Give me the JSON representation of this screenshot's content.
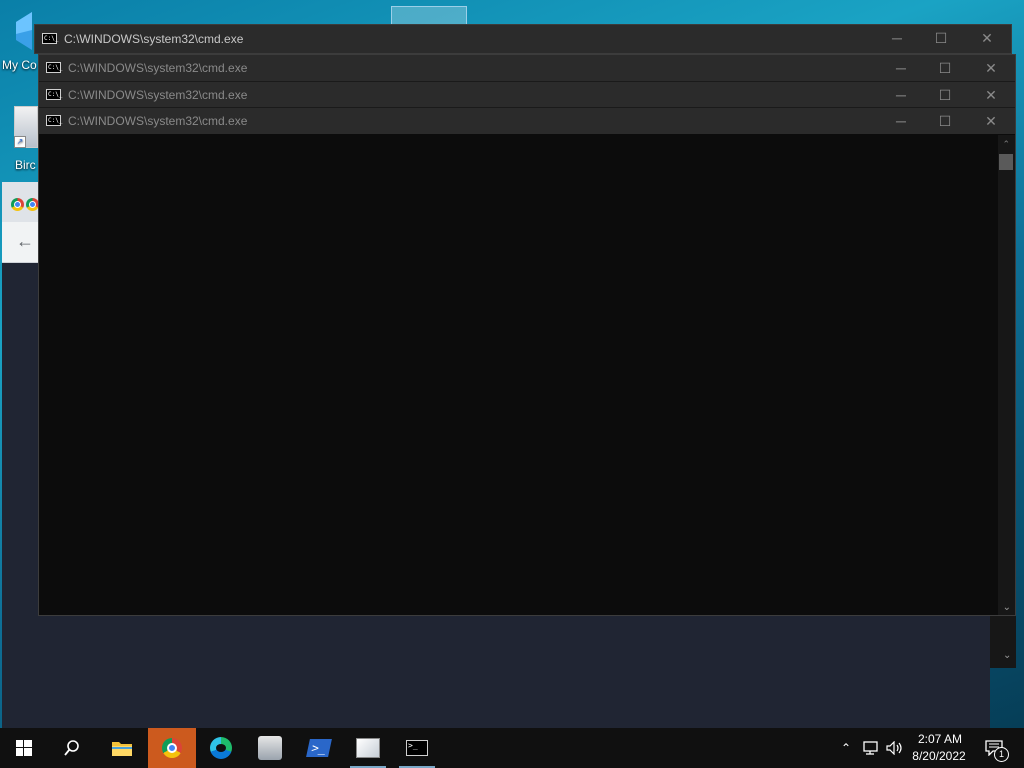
{
  "desktop": {
    "icons": [
      {
        "label": "My Co",
        "icon": "computer-icon"
      },
      {
        "label": "Birc",
        "icon": "shortcut-icon"
      }
    ]
  },
  "cmd_windows": [
    {
      "title": "C:\\WINDOWS\\system32\\cmd.exe"
    },
    {
      "title": "C:\\WINDOWS\\system32\\cmd.exe"
    },
    {
      "title": "C:\\WINDOWS\\system32\\cmd.exe"
    },
    {
      "title": "C:\\WINDOWS\\system32\\cmd.exe"
    }
  ],
  "window_controls": {
    "minimize": "─",
    "maximize": "☐",
    "close": "✕"
  },
  "taskbar": {
    "apps": [
      {
        "name": "start",
        "icon": "windows-start-icon"
      },
      {
        "name": "search",
        "icon": "search-icon"
      },
      {
        "name": "file-explorer",
        "icon": "folder-icon"
      },
      {
        "name": "chrome",
        "icon": "chrome-icon",
        "active": true
      },
      {
        "name": "edge",
        "icon": "edge-icon"
      },
      {
        "name": "anime-app",
        "icon": "character-icon"
      },
      {
        "name": "powershell",
        "icon": "powershell-icon"
      },
      {
        "name": "paint",
        "icon": "paint-icon",
        "running": true
      },
      {
        "name": "cmd",
        "icon": "cmd-icon",
        "running": true
      }
    ],
    "tray": {
      "time": "2:07 AM",
      "date": "8/20/2022",
      "notification_count": "1"
    }
  },
  "colors": {
    "accent": "#cc5a1e",
    "taskbar": "#101010",
    "cmd_bg": "#0c0c0c",
    "titlebar": "#2b2b2b"
  }
}
